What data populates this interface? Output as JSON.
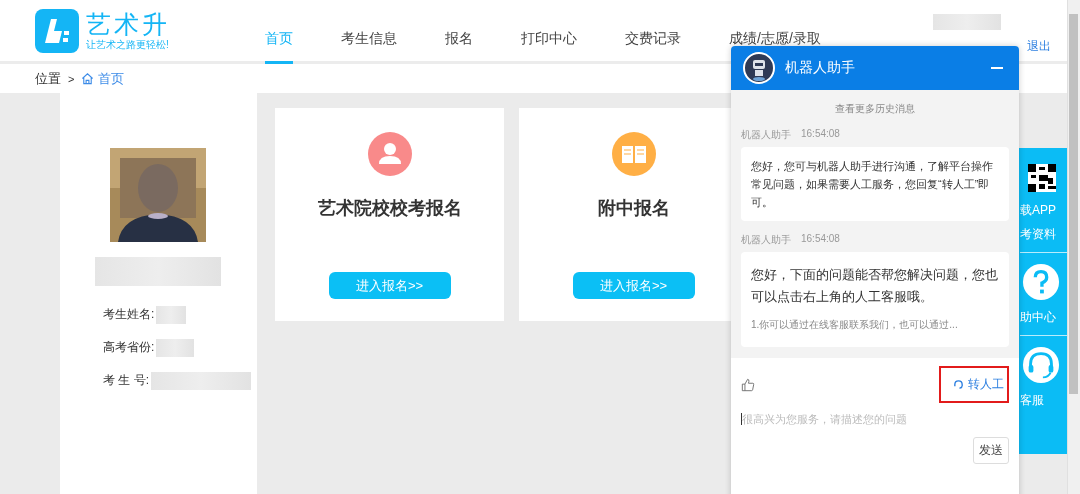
{
  "logo": {
    "name": "艺术升",
    "slogan": "让艺术之路更轻松!"
  },
  "nav": [
    {
      "label": "首页",
      "selected": true
    },
    {
      "label": "考生信息",
      "selected": false
    },
    {
      "label": "报名",
      "selected": false
    },
    {
      "label": "打印中心",
      "selected": false
    },
    {
      "label": "交费记录",
      "selected": false
    },
    {
      "label": "成绩/志愿/录取",
      "selected": false
    }
  ],
  "account": {
    "links": [
      "退出"
    ]
  },
  "breadcrumb": {
    "label": "位置",
    "separator": ">",
    "current": "首页"
  },
  "profile": {
    "fields": [
      {
        "label": "考生姓名:"
      },
      {
        "label": "高考省份:"
      },
      {
        "label": "考 生 号:"
      }
    ]
  },
  "cards": [
    {
      "title": "艺术院校校考报名",
      "button": "进入报名>>",
      "kind": "person",
      "color": "#f98a8a"
    },
    {
      "title": "附中报名",
      "button": "进入报名>>",
      "kind": "book",
      "color": "#ffaf45"
    }
  ],
  "side_bar": {
    "items": [
      {
        "label": "载APP",
        "kind": "qr"
      },
      {
        "label": "考资料",
        "kind": "text"
      },
      {
        "label": "助中心",
        "kind": "help"
      },
      {
        "label": "客服",
        "kind": "service"
      }
    ]
  },
  "chat": {
    "title": "机器人助手",
    "history_link": "查看更多历史消息",
    "messages": [
      {
        "sender": "机器人助手",
        "time": "16:54:08",
        "text": "您好，您可与机器人助手进行沟通，了解平台操作常见问题，如果需要人工服务，您回复“转人工”即可。"
      },
      {
        "sender": "机器人助手",
        "time": "16:54:08",
        "text": "您好，下面的问题能否帮您解决问题，您也可以点击右上角的人工客服哦。",
        "options": [
          "1.你可以通过在线客服联系我们，也可以通过..."
        ]
      }
    ],
    "transfer_button": "转人工",
    "input": {
      "placeholder": "很高兴为您服务，请描述您的问题"
    },
    "send_button": "发送"
  }
}
